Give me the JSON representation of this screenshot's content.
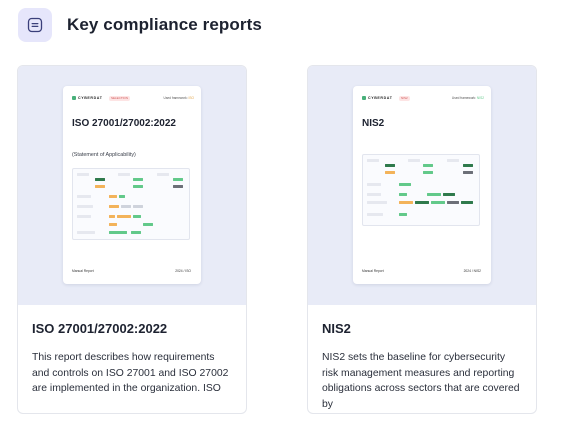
{
  "header": {
    "icon": "document-list-icon",
    "title": "Key compliance reports"
  },
  "cards": [
    {
      "title": "ISO 27001/27002:2022",
      "description": "This report describes how requirements and controls on ISO 27001 and ISO 27002 are implemented in the organization. ISO",
      "preview": {
        "logo_text": "CYBERDAT",
        "pill_text": "SELECTION",
        "framework_text": "Used framework:",
        "framework_value": "ISO",
        "doc_title": "ISO 27001/27002:2022",
        "doc_subtitle": "(Statement of Applicability)",
        "footer_left": "Manual Report",
        "footer_right": "2024 / ISO"
      }
    },
    {
      "title": "NIS2",
      "description": "NIS2 sets the baseline for cybersecurity risk management measures and reporting obligations across sectors that are covered by",
      "preview": {
        "logo_text": "CYBERDAT",
        "pill_text": "NIS2",
        "framework_text": "Used framework:",
        "framework_value": "NIS2",
        "doc_title": "NIS2",
        "doc_subtitle": "",
        "footer_left": "Manual Report",
        "footer_right": "2024 / NIS2"
      }
    }
  ],
  "colors": {
    "preview_bg": "#e8ebf7",
    "accent_icon_bg": "#e6e6fb",
    "status_green": "#62c98a",
    "status_orange": "#f3b35a",
    "status_dark_green": "#2f7a4c"
  }
}
